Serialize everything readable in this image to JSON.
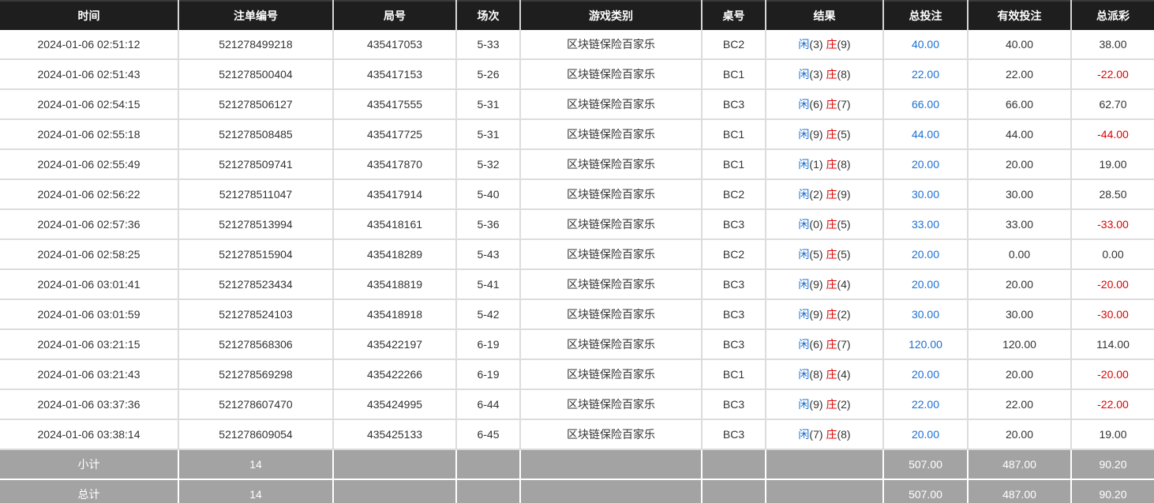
{
  "colors": {
    "header_bg": "#1e1e1e",
    "summary_bg": "#a3a3a3",
    "player_blue": "#1a6fd4",
    "banker_red": "#e00000",
    "negative_red": "#e00000"
  },
  "table": {
    "headers": [
      "时间",
      "注单编号",
      "局号",
      "场次",
      "游戏类别",
      "桌号",
      "结果",
      "总投注",
      "有效投注",
      "总派彩"
    ],
    "rows": [
      {
        "time": "2024-01-06 02:51:12",
        "bet_no": "521278499218",
        "round_no": "435417053",
        "session": "5-33",
        "game": "区块链保险百家乐",
        "table": "BC2",
        "player_label": "闲",
        "player_score": "(3)",
        "banker_label": "庄",
        "banker_score": "(9)",
        "total_bet": "40.00",
        "valid_bet": "40.00",
        "payout": "38.00"
      },
      {
        "time": "2024-01-06 02:51:43",
        "bet_no": "521278500404",
        "round_no": "435417153",
        "session": "5-26",
        "game": "区块链保险百家乐",
        "table": "BC1",
        "player_label": "闲",
        "player_score": "(3)",
        "banker_label": "庄",
        "banker_score": "(8)",
        "total_bet": "22.00",
        "valid_bet": "22.00",
        "payout": "-22.00"
      },
      {
        "time": "2024-01-06 02:54:15",
        "bet_no": "521278506127",
        "round_no": "435417555",
        "session": "5-31",
        "game": "区块链保险百家乐",
        "table": "BC3",
        "player_label": "闲",
        "player_score": "(6)",
        "banker_label": "庄",
        "banker_score": "(7)",
        "total_bet": "66.00",
        "valid_bet": "66.00",
        "payout": "62.70"
      },
      {
        "time": "2024-01-06 02:55:18",
        "bet_no": "521278508485",
        "round_no": "435417725",
        "session": "5-31",
        "game": "区块链保险百家乐",
        "table": "BC1",
        "player_label": "闲",
        "player_score": "(9)",
        "banker_label": "庄",
        "banker_score": "(5)",
        "total_bet": "44.00",
        "valid_bet": "44.00",
        "payout": "-44.00"
      },
      {
        "time": "2024-01-06 02:55:49",
        "bet_no": "521278509741",
        "round_no": "435417870",
        "session": "5-32",
        "game": "区块链保险百家乐",
        "table": "BC1",
        "player_label": "闲",
        "player_score": "(1)",
        "banker_label": "庄",
        "banker_score": "(8)",
        "total_bet": "20.00",
        "valid_bet": "20.00",
        "payout": "19.00"
      },
      {
        "time": "2024-01-06 02:56:22",
        "bet_no": "521278511047",
        "round_no": "435417914",
        "session": "5-40",
        "game": "区块链保险百家乐",
        "table": "BC2",
        "player_label": "闲",
        "player_score": "(2)",
        "banker_label": "庄",
        "banker_score": "(9)",
        "total_bet": "30.00",
        "valid_bet": "30.00",
        "payout": "28.50"
      },
      {
        "time": "2024-01-06 02:57:36",
        "bet_no": "521278513994",
        "round_no": "435418161",
        "session": "5-36",
        "game": "区块链保险百家乐",
        "table": "BC3",
        "player_label": "闲",
        "player_score": "(0)",
        "banker_label": "庄",
        "banker_score": "(5)",
        "total_bet": "33.00",
        "valid_bet": "33.00",
        "payout": "-33.00"
      },
      {
        "time": "2024-01-06 02:58:25",
        "bet_no": "521278515904",
        "round_no": "435418289",
        "session": "5-43",
        "game": "区块链保险百家乐",
        "table": "BC2",
        "player_label": "闲",
        "player_score": "(5)",
        "banker_label": "庄",
        "banker_score": "(5)",
        "total_bet": "20.00",
        "valid_bet": "0.00",
        "payout": "0.00"
      },
      {
        "time": "2024-01-06 03:01:41",
        "bet_no": "521278523434",
        "round_no": "435418819",
        "session": "5-41",
        "game": "区块链保险百家乐",
        "table": "BC3",
        "player_label": "闲",
        "player_score": "(9)",
        "banker_label": "庄",
        "banker_score": "(4)",
        "total_bet": "20.00",
        "valid_bet": "20.00",
        "payout": "-20.00"
      },
      {
        "time": "2024-01-06 03:01:59",
        "bet_no": "521278524103",
        "round_no": "435418918",
        "session": "5-42",
        "game": "区块链保险百家乐",
        "table": "BC3",
        "player_label": "闲",
        "player_score": "(9)",
        "banker_label": "庄",
        "banker_score": "(2)",
        "total_bet": "30.00",
        "valid_bet": "30.00",
        "payout": "-30.00"
      },
      {
        "time": "2024-01-06 03:21:15",
        "bet_no": "521278568306",
        "round_no": "435422197",
        "session": "6-19",
        "game": "区块链保险百家乐",
        "table": "BC3",
        "player_label": "闲",
        "player_score": "(6)",
        "banker_label": "庄",
        "banker_score": "(7)",
        "total_bet": "120.00",
        "valid_bet": "120.00",
        "payout": "114.00"
      },
      {
        "time": "2024-01-06 03:21:43",
        "bet_no": "521278569298",
        "round_no": "435422266",
        "session": "6-19",
        "game": "区块链保险百家乐",
        "table": "BC1",
        "player_label": "闲",
        "player_score": "(8)",
        "banker_label": "庄",
        "banker_score": "(4)",
        "total_bet": "20.00",
        "valid_bet": "20.00",
        "payout": "-20.00"
      },
      {
        "time": "2024-01-06 03:37:36",
        "bet_no": "521278607470",
        "round_no": "435424995",
        "session": "6-44",
        "game": "区块链保险百家乐",
        "table": "BC3",
        "player_label": "闲",
        "player_score": "(9)",
        "banker_label": "庄",
        "banker_score": "(2)",
        "total_bet": "22.00",
        "valid_bet": "22.00",
        "payout": "-22.00"
      },
      {
        "time": "2024-01-06 03:38:14",
        "bet_no": "521278609054",
        "round_no": "435425133",
        "session": "6-45",
        "game": "区块链保险百家乐",
        "table": "BC3",
        "player_label": "闲",
        "player_score": "(7)",
        "banker_label": "庄",
        "banker_score": "(8)",
        "total_bet": "20.00",
        "valid_bet": "20.00",
        "payout": "19.00"
      }
    ],
    "subtotal": {
      "label": "小计",
      "count": "14",
      "total_bet": "507.00",
      "valid_bet": "487.00",
      "payout": "90.20"
    },
    "grand_total": {
      "label": "总计",
      "count": "14",
      "total_bet": "507.00",
      "valid_bet": "487.00",
      "payout": "90.20"
    }
  }
}
